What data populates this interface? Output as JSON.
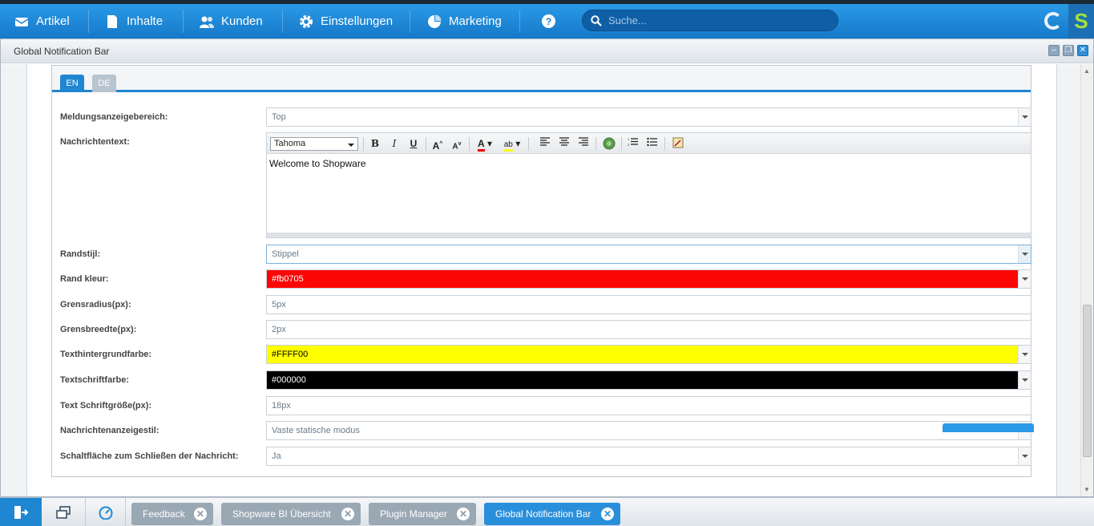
{
  "topnav": {
    "items": [
      {
        "label": "Artikel",
        "icon": "article-icon"
      },
      {
        "label": "Inhalte",
        "icon": "content-icon"
      },
      {
        "label": "Kunden",
        "icon": "customers-icon"
      },
      {
        "label": "Einstellungen",
        "icon": "gear-icon"
      },
      {
        "label": "Marketing",
        "icon": "pie-chart-icon"
      }
    ],
    "help_icon": "help-icon",
    "search_placeholder": "Suche..."
  },
  "window": {
    "title": "Global Notification Bar",
    "tabs": [
      "EN",
      "DE"
    ],
    "fields": {
      "area": {
        "label": "Meldungsanzeigebereich:",
        "value": "Top"
      },
      "text": {
        "label": "Nachrichtentext:",
        "font": "Tahoma",
        "content": "Welcome to Shopware"
      },
      "border_style": {
        "label": "Randstijl:",
        "value": "Stippel"
      },
      "border_color": {
        "label": "Rand kleur:",
        "value": "#fb0705",
        "color": "#fb0705"
      },
      "border_radius": {
        "label": "Grensradius(px):",
        "value": "5px"
      },
      "border_width": {
        "label": "Grensbreedte(px):",
        "value": "2px"
      },
      "text_bg": {
        "label": "Texthintergrundfarbe:",
        "value": "#FFFF00",
        "color": "#FFFF00"
      },
      "text_color": {
        "label": "Textschriftfarbe:",
        "value": "#000000",
        "color": "#000000"
      },
      "font_size": {
        "label": "Text Schriftgröße(px):",
        "value": "18px"
      },
      "display_style": {
        "label": "Nachrichtenanzeigestil:",
        "value": "Vaste statische modus"
      },
      "close_button": {
        "label": "Schaltfläche zum Schließen der Nachricht:",
        "value": "Ja"
      }
    }
  },
  "taskbar": {
    "tasks": [
      "Feedback",
      "Shopware BI Übersicht",
      "Plugin Manager",
      "Global Notification Bar"
    ]
  }
}
